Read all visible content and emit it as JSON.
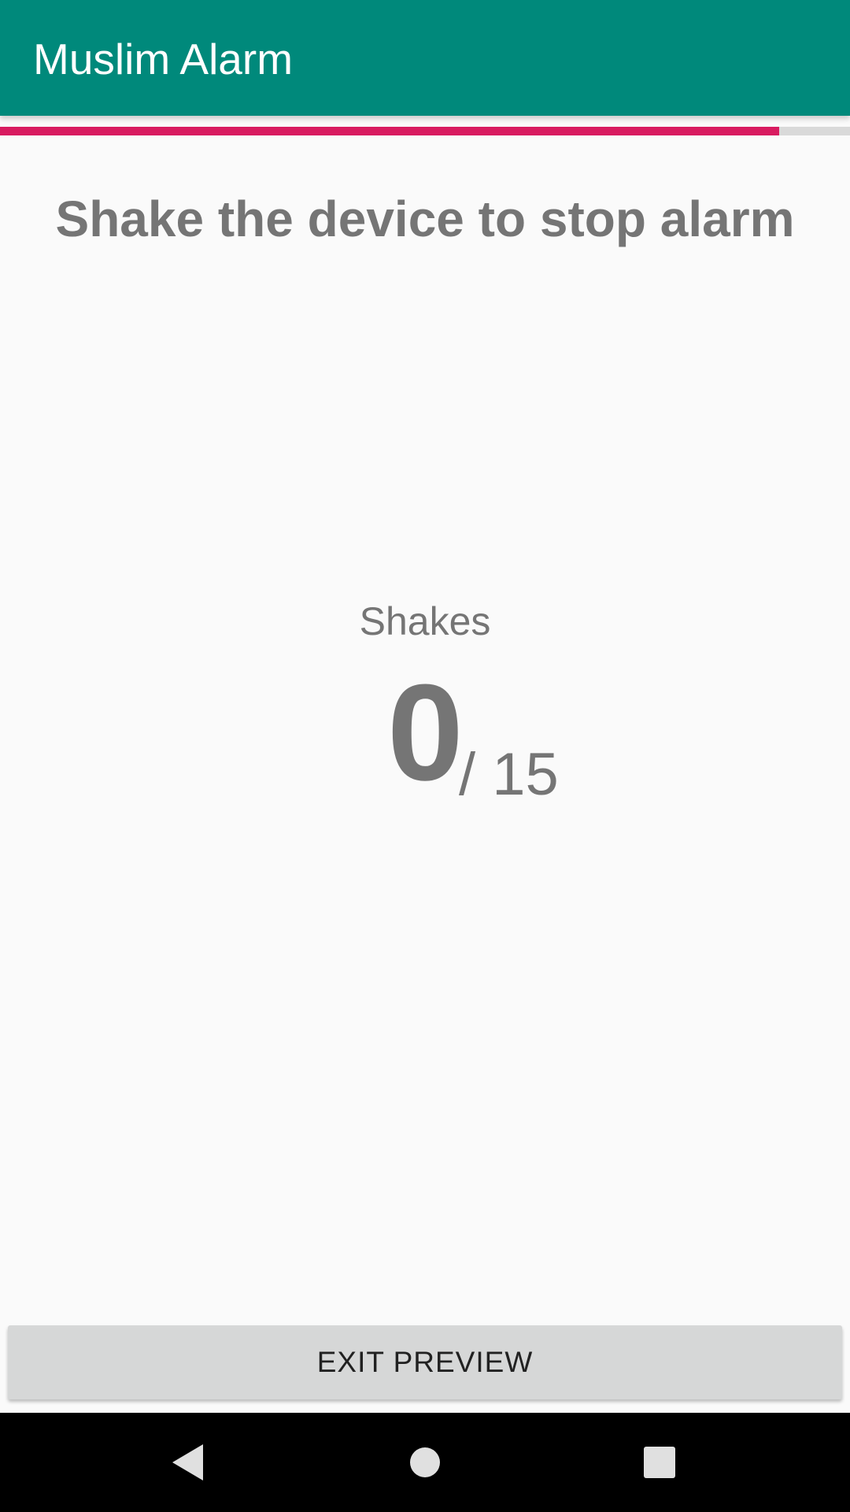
{
  "app_bar": {
    "title": "Muslim Alarm",
    "color": "#00897b"
  },
  "progress": {
    "fraction": 0.917,
    "fill_color": "#d81b60",
    "track_color": "#d9d9d9"
  },
  "instruction": "Shake the device to stop alarm",
  "shakes": {
    "label": "Shakes",
    "current": "0",
    "total": "/ 15"
  },
  "exit_button": {
    "label": "EXIT PREVIEW"
  },
  "nav_bar": {
    "back_icon": "back-triangle-icon",
    "home_icon": "home-circle-icon",
    "recents_icon": "recents-square-icon"
  }
}
